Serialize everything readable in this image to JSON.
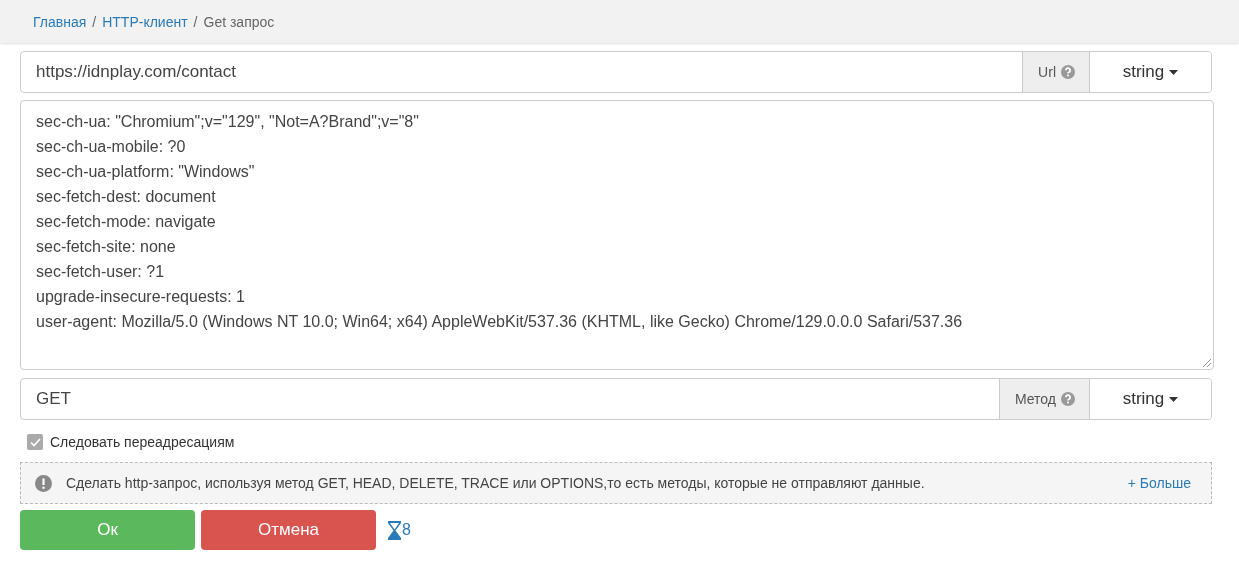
{
  "breadcrumb": [
    {
      "label": "Главная",
      "kind": "link"
    },
    {
      "label": "/",
      "kind": "separator"
    },
    {
      "label": "HTTP-клиент",
      "kind": "link"
    },
    {
      "label": "/",
      "kind": "separator"
    },
    {
      "label": "Get запрос",
      "kind": "current"
    }
  ],
  "url_field": {
    "value": "https://idnplay.com/contact",
    "addon": "Url",
    "type": "string"
  },
  "headers": [
    "sec-ch-ua: \"Chromium\";v=\"129\", \"Not=A?Brand\";v=\"8\"",
    "sec-ch-ua-mobile: ?0",
    "sec-ch-ua-platform: \"Windows\"",
    "sec-fetch-dest: document",
    "sec-fetch-mode: navigate",
    "sec-fetch-site: none",
    "sec-fetch-user: ?1",
    "upgrade-insecure-requests: 1",
    "user-agent: Mozilla/5.0 (Windows NT 10.0; Win64; x64) AppleWebKit/537.36 (KHTML, like Gecko) Chrome/129.0.0.0 Safari/537.36"
  ],
  "method_field": {
    "value": "GET",
    "addon": "Метод",
    "type": "string"
  },
  "follow_redirects": {
    "label": "Следовать переадресациям",
    "checked": true
  },
  "note": {
    "text": "Сделать http-запрос, используя метод GET, HEAD, DELETE, TRACE или OPTIONS,то есть методы, которые не отправляют данные.",
    "more": "+ Больше"
  },
  "buttons": [
    {
      "label": "Ок",
      "kind": "primary"
    },
    {
      "label": "Отмена",
      "kind": "danger"
    }
  ],
  "timer": {
    "count": "8"
  }
}
